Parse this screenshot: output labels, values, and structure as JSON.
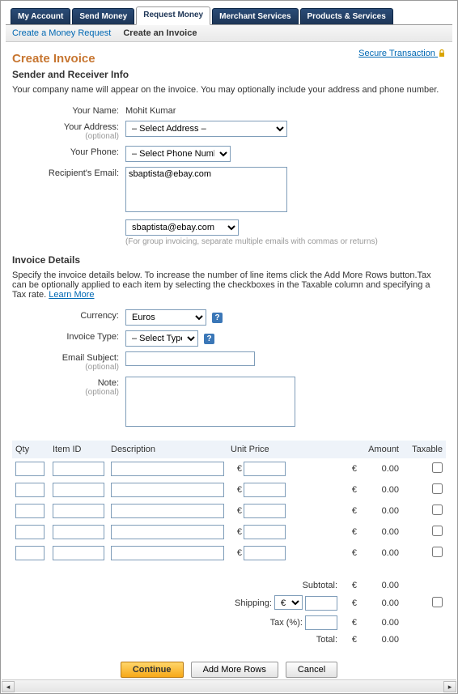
{
  "tabs": {
    "main": [
      "My Account",
      "Send Money",
      "Request Money",
      "Merchant Services",
      "Products & Services"
    ],
    "main_active_index": 2,
    "sub": [
      "Create a Money Request",
      "Create an Invoice"
    ],
    "sub_active_index": 1
  },
  "secure_link": "Secure Transaction",
  "page_title": "Create Invoice",
  "sender": {
    "section_title": "Sender and Receiver Info",
    "hint": "Your company name will appear on the invoice. You may optionally include your address and phone number.",
    "labels": {
      "your_name": "Your Name:",
      "your_address": "Your Address:",
      "your_address_opt": "(optional)",
      "your_phone": "Your Phone:",
      "recipient_email": "Recipient's Email:"
    },
    "your_name_value": "Mohit Kumar",
    "address_placeholder": "– Select Address –",
    "phone_placeholder": "– Select Phone Number –",
    "recipient_email_value": "sbaptista@ebay.com",
    "recipient_select_value": "sbaptista@ebay.com",
    "group_hint": "(For group invoicing, separate multiple emails with commas or returns)"
  },
  "details": {
    "section_title": "Invoice Details",
    "hint_prefix": "Specify the invoice details below. To increase the number of line items click the Add More Rows button.Tax can be optionally applied to each item by selecting the checkboxes in the Taxable column and specifying a Tax rate. ",
    "learn_more": "Learn More",
    "labels": {
      "currency": "Currency:",
      "invoice_type": "Invoice Type:",
      "email_subject": "Email Subject:",
      "email_subject_opt": "(optional)",
      "note": "Note:",
      "note_opt": "(optional)"
    },
    "currency_value": "Euros",
    "invoice_type_placeholder": "– Select Type –"
  },
  "table": {
    "headers": {
      "qty": "Qty",
      "item_id": "Item ID",
      "description": "Description",
      "unit_price": "Unit Price",
      "amount": "Amount",
      "taxable": "Taxable"
    },
    "currency_symbol": "€",
    "rows": [
      {
        "amount": "0.00"
      },
      {
        "amount": "0.00"
      },
      {
        "amount": "0.00"
      },
      {
        "amount": "0.00"
      },
      {
        "amount": "0.00"
      }
    ]
  },
  "summary": {
    "subtotal_label": "Subtotal:",
    "shipping_label": "Shipping:",
    "tax_label": "Tax (%):",
    "total_label": "Total:",
    "subtotal": "0.00",
    "shipping": "0.00",
    "tax": "0.00",
    "total": "0.00",
    "shipping_currency": "€"
  },
  "buttons": {
    "continue": "Continue",
    "add_more": "Add More Rows",
    "cancel": "Cancel"
  }
}
